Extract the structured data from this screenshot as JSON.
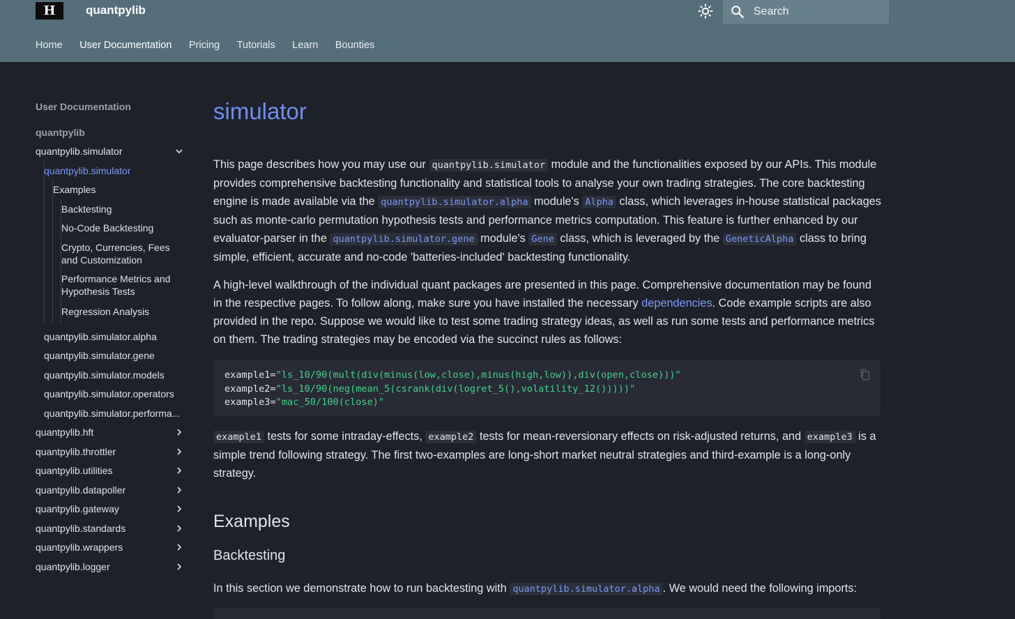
{
  "header": {
    "logo_text": "H",
    "site_title": "quantpylib",
    "search_placeholder": "Search",
    "tabs": [
      "Home",
      "User Documentation",
      "Pricing",
      "Tutorials",
      "Learn",
      "Bounties"
    ],
    "active_tab": "User Documentation",
    "icons": {
      "theme": "brightness-icon",
      "search": "search-icon"
    }
  },
  "sidebar": {
    "title": "User Documentation",
    "root": "quantpylib",
    "items": [
      "quantpylib.simulator",
      "quantpylib.simulator",
      "Examples",
      "Backtesting",
      "No-Code Backtesting",
      "Crypto, Currencies, Fees and Customization",
      "Performance Metrics and Hypothesis Tests",
      "Regression Analysis",
      "quantpylib.simulator.alpha",
      "quantpylib.simulator.gene",
      "quantpylib.simulator.models",
      "quantpylib.simulator.operators",
      "quantpylib.simulator.performa...",
      "quantpylib.hft",
      "quantpylib.throttler",
      "quantpylib.utilities",
      "quantpylib.datapoller",
      "quantpylib.gateway",
      "quantpylib.standards",
      "quantpylib.wrappers",
      "quantpylib.logger"
    ]
  },
  "content": {
    "title": "simulator",
    "p1": {
      "t1": "This page describes how you may use our ",
      "c1": "quantpylib.simulator",
      "t2": " module and the functionalities exposed by our APIs. This module provides comprehensive backtesting functionality and statistical tools to analyse your own trading strategies. The core backtesting engine is made available via the ",
      "c2": "quantpylib.simulator.alpha",
      "t3": " module's ",
      "c3": "Alpha",
      "t4": " class, which leverages in-house statistical packages such as monte-carlo permutation hypothesis tests and performance metrics computation. This feature is further enhanced by our evaluator-parser in the ",
      "c4": "quantpylib.simulator.gene",
      "t5": " module's ",
      "c5": "Gene",
      "t6": " class, which is leveraged by the ",
      "c6": "GeneticAlpha",
      "t7": " class to bring simple, efficient, accurate and no-code 'batteries-included' backtesting functionality."
    },
    "p2": {
      "t1": "A high-level walkthrough of the individual quant packages are presented in this page. Comprehensive documentation may be found in the respective pages. To follow along, make sure you have installed the necessary ",
      "link": "dependencies",
      "t2": ". Code example scripts are also provided in the repo. Suppose we would like to test some trading strategy ideas, as well as run some tests and performance metrics on them. The trading strategies may be encoded via the succinct rules as follows:"
    },
    "code": {
      "lines": [
        {
          "var": "example1",
          "op": "=",
          "str": "\"ls_10/90(mult(div(minus(low,close),minus(high,low)),div(open,close)))\""
        },
        {
          "var": "example2",
          "op": "=",
          "str": "\"ls_10/90(neg(mean_5(csrank(div(logret_5(),volatility_12()))))\""
        },
        {
          "var": "example3",
          "op": "=",
          "str": "\"mac_50/100(close)\""
        }
      ]
    },
    "p3": {
      "c1": "example1",
      "t1": " tests for some intraday-effects, ",
      "c2": "example2",
      "t2": " tests for mean-reversionary effects on risk-adjusted returns, and ",
      "c3": "example3",
      "t3": " is a simple trend following strategy. The first two-examples are long-short market neutral strategies and third-example is a long-only strategy."
    },
    "h2": "Examples",
    "h3": "Backtesting",
    "p4": {
      "t1": "In this section we demonstrate how to run backtesting with ",
      "c1": "quantpylib.simulator.alpha",
      "t2": ". We would need the following imports:"
    }
  },
  "colors": {
    "header_bg": "#546e7a",
    "page_bg": "#1e2129",
    "accent": "#7b9af7",
    "code_string": "#43d18b"
  }
}
